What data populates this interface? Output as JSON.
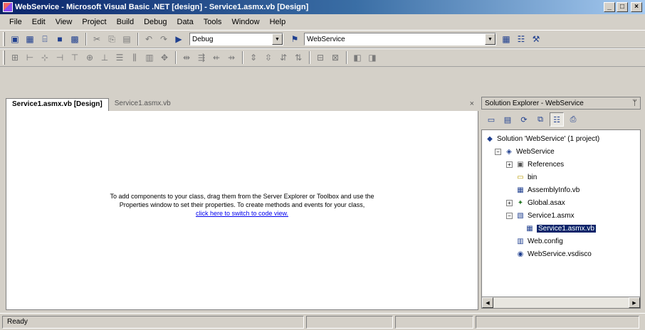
{
  "window": {
    "title": "WebService - Microsoft Visual Basic .NET [design] - Service1.asmx.vb [Design]",
    "minimize": "_",
    "maximize": "□",
    "close": "×"
  },
  "menu": [
    "File",
    "Edit",
    "View",
    "Project",
    "Build",
    "Debug",
    "Data",
    "Tools",
    "Window",
    "Help"
  ],
  "toolbar": {
    "config_combo": "Debug",
    "find_combo": "WebService"
  },
  "tabs": {
    "active": "Service1.asmx.vb [Design]",
    "inactive": "Service1.asmx.vb",
    "close": "×"
  },
  "design_message": {
    "line1": "To add components to your class, drag them from the Server Explorer or Toolbox and use the",
    "line2": "Properties window to set their properties. To create methods and events for your class,",
    "link": "click here to switch to code view."
  },
  "solution_explorer": {
    "title": "Solution Explorer - WebService",
    "pin": "ᛘ",
    "nodes": [
      {
        "label": "Solution 'WebService' (1 project)",
        "icon": "solution-icon"
      },
      {
        "label": "WebService",
        "icon": "project-icon"
      },
      {
        "label": "References",
        "icon": "references-icon"
      },
      {
        "label": "bin",
        "icon": "folder-icon"
      },
      {
        "label": "AssemblyInfo.vb",
        "icon": "vb-file-icon"
      },
      {
        "label": "Global.asax",
        "icon": "global-icon"
      },
      {
        "label": "Service1.asmx",
        "icon": "asmx-icon"
      },
      {
        "label": "Service1.asmx.vb",
        "icon": "vb-file-icon"
      },
      {
        "label": "Web.config",
        "icon": "config-icon"
      },
      {
        "label": "WebService.vsdisco",
        "icon": "disco-icon"
      }
    ]
  },
  "status": {
    "text": "Ready"
  }
}
